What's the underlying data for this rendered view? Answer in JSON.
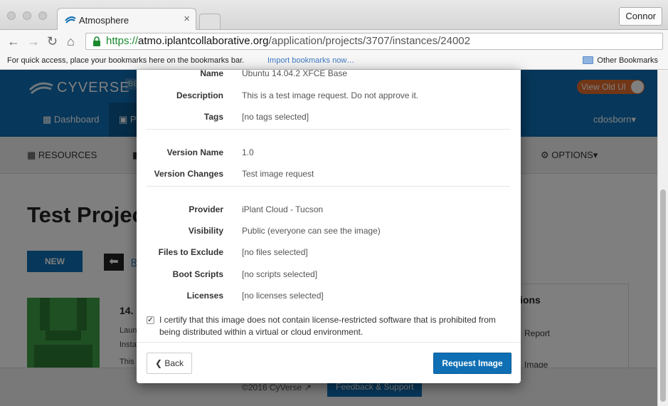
{
  "browser": {
    "tab_title": "Atmosphere",
    "tab_close": "×",
    "profile_name": "Connor",
    "url_scheme": "https://",
    "url_host": "atmo.iplantcollaborative.org",
    "url_path": "/application/projects/3707/instances/24002",
    "bookmarks_hint": "For quick access, place your bookmarks here on the bookmarks bar.",
    "import_link": "Import bookmarks now…",
    "other_bookmarks": "Other Bookmarks"
  },
  "site": {
    "brand": "CYVERSE",
    "brand_badge": "BE",
    "view_old_ui": "View Old UI",
    "nav_dashboard": "Dashboard",
    "nav_projects_partial": "P",
    "user": "cdosborn",
    "subnav_resources": "RESOURCES",
    "subnav_options": "OPTIONS",
    "page_title": "Test Projec",
    "new_button": "NEW",
    "back_link": "R",
    "card_title": "14.",
    "card_line1": "Laun",
    "card_line2": "Insta",
    "card_line3": "This",
    "side_title": "ions",
    "side_item1": "Report",
    "side_item2": "Image",
    "footer_copyright": "©2016 CyVerse",
    "footer_support": "Feedback & Support"
  },
  "modal": {
    "fields_group1": [
      {
        "label": "Name",
        "value": "Ubuntu 14.04.2 XFCE Base"
      },
      {
        "label": "Description",
        "value": "This is a test image request. Do not approve it."
      },
      {
        "label": "Tags",
        "value": "[no tags selected]"
      }
    ],
    "fields_group2": [
      {
        "label": "Version Name",
        "value": "1.0"
      },
      {
        "label": "Version Changes",
        "value": "Test image request"
      }
    ],
    "fields_group3": [
      {
        "label": "Provider",
        "value": "iPlant Cloud - Tucson"
      },
      {
        "label": "Visibility",
        "value": "Public (everyone can see the image)"
      },
      {
        "label": "Files to Exclude",
        "value": "[no files selected]"
      },
      {
        "label": "Boot Scripts",
        "value": "[no scripts selected]"
      },
      {
        "label": "Licenses",
        "value": "[no licenses selected]"
      }
    ],
    "certify_text": "I certify that this image does not contain license-restricted software that is prohibited from being distributed within a virtual or cloud environment.",
    "certify_checked": true,
    "back_label": "Back",
    "request_label": "Request Image"
  },
  "colors": {
    "brand_blue": "#0f6fb4",
    "view_old_orange": "#e36c2c",
    "url_green": "#1b8a2e"
  }
}
